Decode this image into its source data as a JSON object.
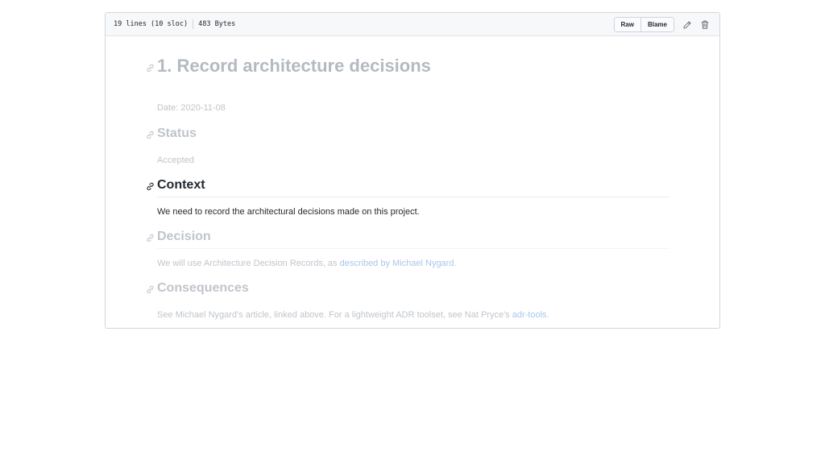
{
  "file_header": {
    "lines": "19 lines (10 sloc)",
    "size": "483 Bytes",
    "raw_label": "Raw",
    "blame_label": "Blame"
  },
  "document": {
    "title": "1. Record architecture decisions",
    "date": "Date: 2020-11-08",
    "status_heading": "Status",
    "status_text": "Accepted",
    "context_heading": "Context",
    "context_text": "We need to record the architectural decisions made on this project.",
    "decision_heading": "Decision",
    "decision_text_before": "We will use Architecture Decision Records, as ",
    "decision_link": "described by Michael Nygard",
    "decision_text_after": ".",
    "consequences_heading": "Consequences",
    "consequences_text_before": "See Michael Nygard's article, linked above. For a lightweight ADR toolset, see Nat Pryce's ",
    "consequences_link": "adr-tools",
    "consequences_text_after": "."
  },
  "colors": {
    "active_text": "#24292e",
    "faded_text": "#c0c5cb",
    "faded_link": "#a9c6ec"
  }
}
